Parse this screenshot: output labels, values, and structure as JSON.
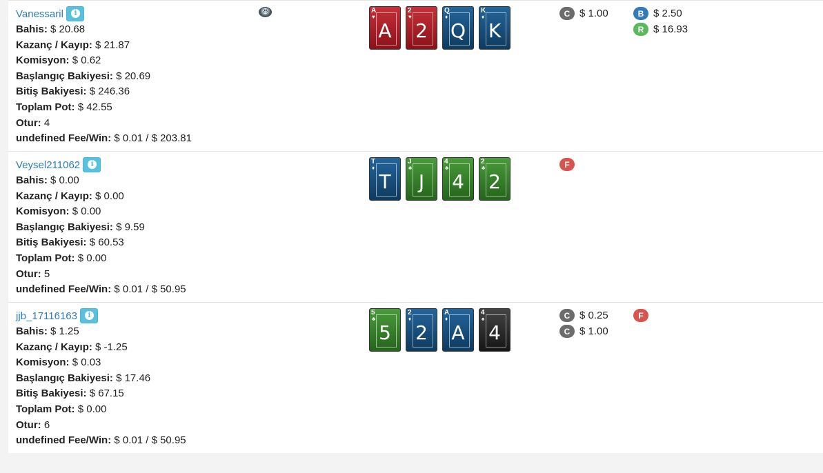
{
  "rows": [
    {
      "name": "Vanessaril",
      "chip": "25",
      "stats": {
        "bahis": "$ 20.68",
        "kazanc": "$ 21.87",
        "komisyon": "$ 0.62",
        "baslangic": "$ 20.69",
        "bitis": "$ 246.36",
        "pot": "$ 42.55",
        "otur": "4",
        "fee": "$ 0.01 / $ 203.81"
      },
      "cards": [
        {
          "rank": "A",
          "suit": "♥",
          "color": "red"
        },
        {
          "rank": "2",
          "suit": "♥",
          "color": "red"
        },
        {
          "rank": "Q",
          "suit": "♦",
          "color": "blue"
        },
        {
          "rank": "K",
          "suit": "♦",
          "color": "blue"
        }
      ],
      "actions1": [
        {
          "badge": "C",
          "color": "#6c6c6c",
          "amount": "$ 1.00"
        }
      ],
      "actions2": [
        {
          "badge": "B",
          "color": "#337ab7",
          "amount": "$ 2.50"
        },
        {
          "badge": "R",
          "color": "#5cb85c",
          "amount": "$ 16.93"
        }
      ]
    },
    {
      "name": "Veysel211062",
      "stats": {
        "bahis": "$ 0.00",
        "kazanc": "$ 0.00",
        "komisyon": "$ 0.00",
        "baslangic": "$ 9.59",
        "bitis": "$ 60.53",
        "pot": "$ 0.00",
        "otur": "5",
        "fee": "$ 0.01 / $ 50.95"
      },
      "cards": [
        {
          "rank": "T",
          "suit": "♦",
          "color": "blue"
        },
        {
          "rank": "J",
          "suit": "♣",
          "color": "green"
        },
        {
          "rank": "4",
          "suit": "♣",
          "color": "green"
        },
        {
          "rank": "2",
          "suit": "♣",
          "color": "green"
        }
      ],
      "actions1": [
        {
          "badge": "F",
          "color": "#d9534f",
          "amount": ""
        }
      ],
      "actions2": []
    },
    {
      "name": "jjb_17116163",
      "stats": {
        "bahis": "$ 1.25",
        "kazanc": "$ -1.25",
        "komisyon": "$ 0.03",
        "baslangic": "$ 17.46",
        "bitis": "$ 67.15",
        "pot": "$ 0.00",
        "otur": "6",
        "fee": "$ 0.01 / $ 50.95"
      },
      "cards": [
        {
          "rank": "5",
          "suit": "♣",
          "color": "green"
        },
        {
          "rank": "2",
          "suit": "♦",
          "color": "blue"
        },
        {
          "rank": "A",
          "suit": "♦",
          "color": "blue"
        },
        {
          "rank": "4",
          "suit": "♠",
          "color": "black"
        }
      ],
      "actions1": [
        {
          "badge": "C",
          "color": "#6c6c6c",
          "amount": "$ 0.25"
        },
        {
          "badge": "C",
          "color": "#6c6c6c",
          "amount": "$ 1.00"
        }
      ],
      "actions2": [
        {
          "badge": "F",
          "color": "#d9534f",
          "amount": ""
        }
      ]
    }
  ],
  "labels": {
    "bahis": "Bahis:",
    "kazanc": "Kazanç / Kayıp:",
    "komisyon": "Komisyon:",
    "baslangic": "Başlangıç Bakiyesi:",
    "bitis": "Bitiş Bakiyesi:",
    "pot": "Toplam Pot:",
    "otur": "Otur:",
    "fee": "undefined Fee/Win:"
  }
}
